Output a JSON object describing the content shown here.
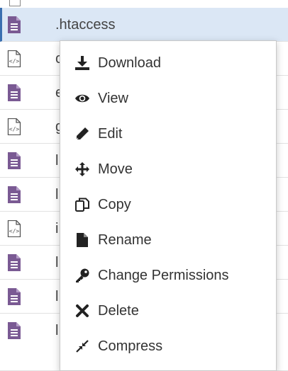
{
  "file_list": {
    "selected_name": ".htaccess",
    "rows": [
      {
        "name": ".htaccess",
        "type": "text"
      },
      {
        "name": "c",
        "type": "code"
      },
      {
        "name": "e",
        "type": "text"
      },
      {
        "name": "g",
        "type": "code"
      },
      {
        "name": "l",
        "type": "text"
      },
      {
        "name": "l",
        "type": "text"
      },
      {
        "name": "i",
        "type": "code"
      },
      {
        "name": "l",
        "type": "text"
      },
      {
        "name": "l",
        "type": "text"
      },
      {
        "name": "l",
        "type": "text"
      }
    ]
  },
  "context_menu": {
    "items": [
      {
        "label": "Download",
        "icon": "download-icon"
      },
      {
        "label": "View",
        "icon": "eye-icon"
      },
      {
        "label": "Edit",
        "icon": "pencil-icon"
      },
      {
        "label": "Move",
        "icon": "move-arrows-icon"
      },
      {
        "label": "Copy",
        "icon": "copy-icon"
      },
      {
        "label": "Rename",
        "icon": "file-icon"
      },
      {
        "label": "Change Permissions",
        "icon": "key-icon"
      },
      {
        "label": "Delete",
        "icon": "close-x-icon"
      },
      {
        "label": "Compress",
        "icon": "compress-icon"
      }
    ]
  },
  "colors": {
    "file_icon": "#7a5a93",
    "selected_row_bg": "#dbe7f5",
    "menu_text": "#333333"
  }
}
